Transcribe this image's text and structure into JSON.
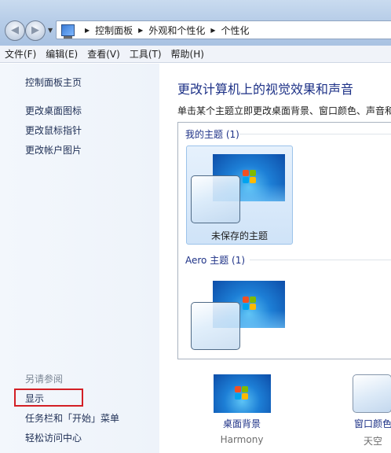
{
  "address_bar": {
    "crumbs": [
      "控制面板",
      "外观和个性化",
      "个性化"
    ]
  },
  "menu": {
    "items": [
      "文件(F)",
      "编辑(E)",
      "查看(V)",
      "工具(T)",
      "帮助(H)"
    ]
  },
  "left_pane": {
    "home_link": "控制面板主页",
    "links": [
      "更改桌面图标",
      "更改鼠标指针",
      "更改帐户图片"
    ],
    "see_also_label": "另请参阅",
    "see_also_links": [
      "显示",
      "任务栏和「开始」菜单",
      "轻松访问中心"
    ]
  },
  "main": {
    "title": "更改计算机上的视觉效果和声音",
    "subtitle": "单击某个主题立即更改桌面背景、窗口颜色、声音和",
    "groups": [
      {
        "header": "我的主题 (1)",
        "themes": [
          "未保存的主题"
        ]
      },
      {
        "header": "Aero 主题 (1)",
        "themes": []
      }
    ]
  },
  "bottom": {
    "background": {
      "label": "桌面背景",
      "value": "Harmony"
    },
    "window_color": {
      "label": "窗口颜色",
      "value": "天空"
    }
  },
  "colors": {
    "highlight_border": "#d31f25",
    "link_color": "#1f2f55",
    "title_color": "#1e3287"
  }
}
